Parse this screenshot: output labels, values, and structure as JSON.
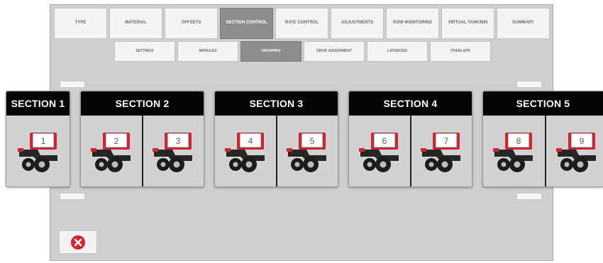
{
  "main_tabs": [
    {
      "label": "TYPE",
      "active": false
    },
    {
      "label": "MATERIAL",
      "active": false
    },
    {
      "label": "OFFSETS",
      "active": false
    },
    {
      "label": "SECTION CONTROL",
      "active": true
    },
    {
      "label": "RATE CONTROL",
      "active": false
    },
    {
      "label": "ADJUSTMENTS",
      "active": false
    },
    {
      "label": "ROW MONITORING",
      "active": false
    },
    {
      "label": "VIRTUAL TANK/BIN",
      "active": false
    },
    {
      "label": "SUMMARY",
      "active": false
    }
  ],
  "sub_tabs": [
    {
      "label": "SETTINGS",
      "active": false
    },
    {
      "label": "MODULES",
      "active": false
    },
    {
      "label": "GROUPING",
      "active": true
    },
    {
      "label": "DRIVE ASSIGNMENT",
      "active": false
    },
    {
      "label": "LATENCIES",
      "active": false
    },
    {
      "label": "OVERLAPS",
      "active": false
    }
  ],
  "sections": [
    {
      "title": "SECTION 1",
      "rows": [
        "1"
      ]
    },
    {
      "title": "SECTION 2",
      "rows": [
        "2",
        "3"
      ]
    },
    {
      "title": "SECTION 3",
      "rows": [
        "4",
        "5"
      ]
    },
    {
      "title": "SECTION 4",
      "rows": [
        "6",
        "7"
      ]
    },
    {
      "title": "SECTION 5",
      "rows": [
        "8",
        "9"
      ]
    }
  ],
  "colors": {
    "active_tab": "#8d8d8d",
    "header": "#050505",
    "accent_red": "#d7232c"
  },
  "icons": {
    "row_unit": "planter-row-unit-icon",
    "close": "close-x-icon"
  }
}
